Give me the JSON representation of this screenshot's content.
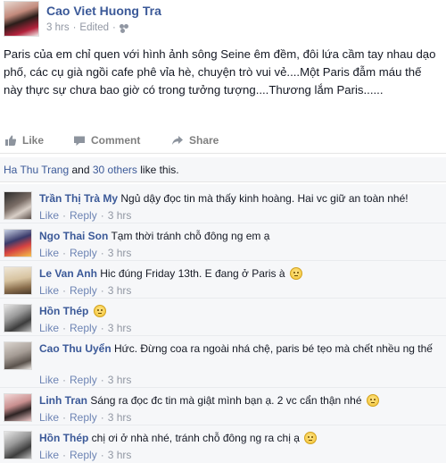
{
  "post": {
    "author": "Cao Viet Huong Tra",
    "time": "3 hrs",
    "edited": "Edited",
    "meta_sep": "·",
    "body": "Paris của em chỉ quen với hình ảnh sông Seine êm đềm, đôi lứa cầm tay nhau dạo phố, các cụ già ngồi cafe phê vỉa hè, chuyện trò vui vẻ....Một Paris đẫm máu thế này thực sự chưa bao giờ có trong tưởng tượng....Thương lắm Paris......"
  },
  "actions": {
    "like": "Like",
    "comment": "Comment",
    "share": "Share"
  },
  "likes": {
    "first": "Ha Thu Trang",
    "and": " and ",
    "others": "30 others",
    "suffix": " like this."
  },
  "comment_actions": {
    "like": "Like",
    "reply": "Reply",
    "sep": "·"
  },
  "comments": [
    {
      "name": "Trần Thị Trà My",
      "text": "Ngủ dậy đọc tin mà thấy kinh hoàng. Hai vc giữ an toàn nhé!",
      "time": "3 hrs",
      "emoji": false
    },
    {
      "name": "Ngo Thai Son",
      "text": "Tạm thời tránh chỗ đông ng em ạ",
      "time": "3 hrs",
      "emoji": false
    },
    {
      "name": "Le Van Anh",
      "text": "Hic đúng Friday 13th. E đang ở Paris à",
      "time": "3 hrs",
      "emoji": true
    },
    {
      "name": "Hồn Thép",
      "text": "",
      "time": "3 hrs",
      "emoji": true
    },
    {
      "name": "Cao Thu Uyển",
      "text": "Hức. Đừng coa ra ngoài nhá chệ, paris bé tẹo mà chết nhều ng thế",
      "time": "3 hrs",
      "emoji": false
    },
    {
      "name": "Linh Tran",
      "text": "Sáng ra đọc đc tin mà giật mình bạn ạ. 2 vc cẩn thận nhé",
      "time": "3 hrs",
      "emoji": true
    },
    {
      "name": "Hồn Thép",
      "text": "chị ơi ở nhà nhé, tránh chỗ đông ng ra chị ạ",
      "time": "3 hrs",
      "emoji": true
    }
  ],
  "colors": {
    "link": "#3b5998",
    "meta": "#9197a3",
    "action": "#7f7f7f"
  },
  "icons": [
    "friends-icon",
    "like-thumb-icon",
    "comment-bubble-icon",
    "share-arrow-icon",
    "smiley-emoji-icon"
  ]
}
